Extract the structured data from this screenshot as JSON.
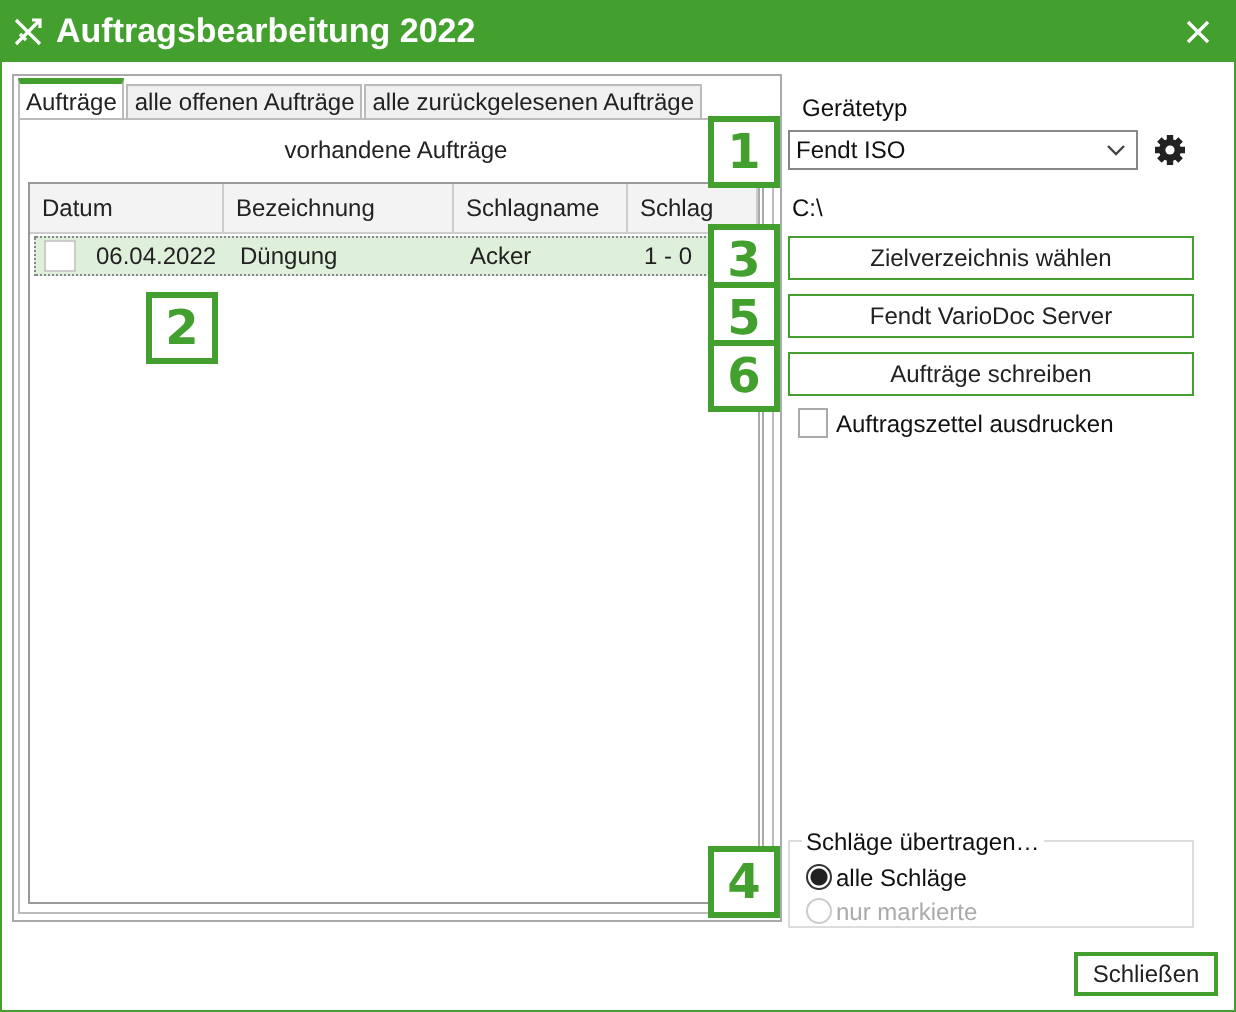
{
  "window": {
    "title": "Auftragsbearbeitung 2022"
  },
  "tabs": [
    {
      "label": "Aufträge",
      "selected": true
    },
    {
      "label": "alle offenen Aufträge",
      "selected": false
    },
    {
      "label": "alle zurückgelesenen Aufträge",
      "selected": false
    }
  ],
  "orders": {
    "caption": "vorhandene Aufträge",
    "callout": "2",
    "columns": [
      "Datum",
      "Bezeichnung",
      "Schlagname",
      "Schlag"
    ],
    "rows": [
      {
        "checked": false,
        "selected": true,
        "cells": [
          "06.04.2022",
          "Düngung",
          "Acker",
          "1 - 0"
        ]
      }
    ]
  },
  "device_type": {
    "label": "Gerätetyp",
    "value": "Fendt ISO",
    "callout": "1"
  },
  "path": "C:\\",
  "buttons": [
    {
      "label": "Zielverzeichnis wählen",
      "callout": "3"
    },
    {
      "label": "Fendt VarioDoc Server",
      "callout": "5"
    },
    {
      "label": "Aufträge schreiben",
      "callout": "6"
    }
  ],
  "print_option": {
    "label": "Auftragszettel ausdrucken",
    "checked": false
  },
  "transfer": {
    "legend": "Schläge übertragen…",
    "callout": "4",
    "options": [
      {
        "label": "alle Schläge",
        "selected": true,
        "disabled": false
      },
      {
        "label": "nur markierte",
        "selected": false,
        "disabled": true
      }
    ]
  },
  "close_button": "Schließen"
}
